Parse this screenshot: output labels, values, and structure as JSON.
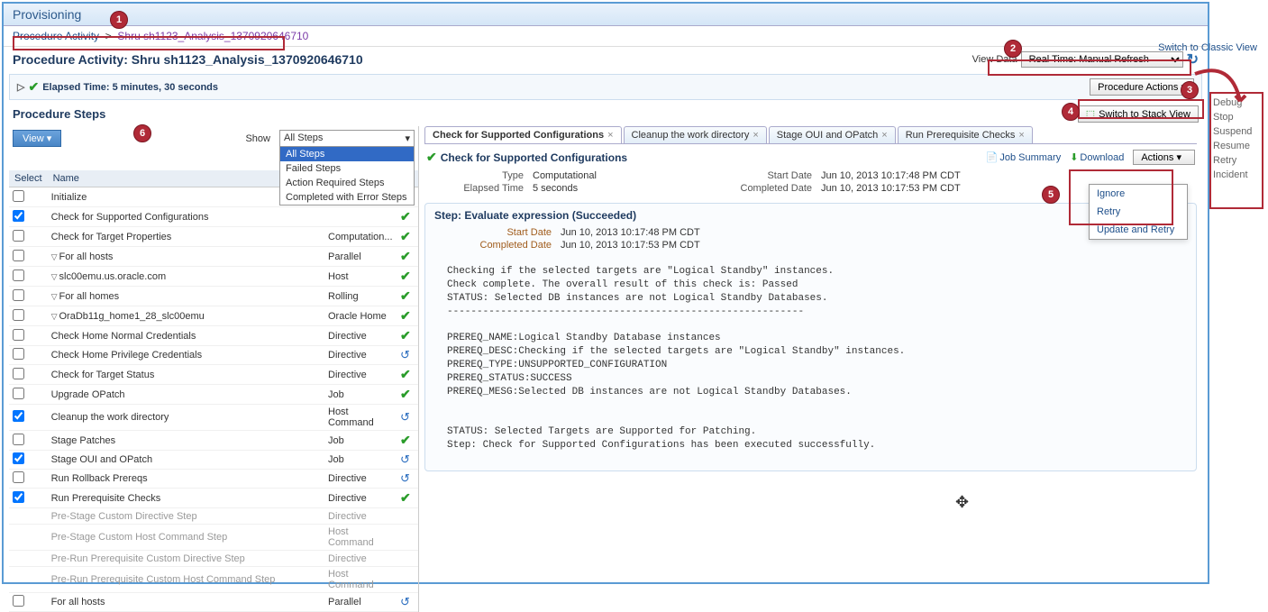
{
  "header": {
    "title": "Provisioning"
  },
  "breadcrumb": {
    "root": "Procedure Activity",
    "current": "Shru sh1123_Analysis_1370920646710"
  },
  "classic_link": "Switch to Classic View",
  "page_title": "Procedure Activity: Shru sh1123_Analysis_1370920646710",
  "viewdata": {
    "label": "View Data",
    "value": "Real Time: Manual Refresh"
  },
  "elapsed": {
    "label": "Elapsed Time: 5 minutes, 30 seconds"
  },
  "proc_actions": "Procedure Actions",
  "steps_header": "Procedure Steps",
  "stack_btn": "Switch to Stack View",
  "toolbar": {
    "view": "View",
    "show": "Show"
  },
  "filter": {
    "current": "All Steps",
    "options": [
      "All Steps",
      "Failed Steps",
      "Action Required Steps",
      "Completed with Error Steps"
    ]
  },
  "table": {
    "col_select": "Select",
    "col_name": "Name",
    "rows": [
      {
        "chk": 0,
        "indent": 1,
        "name": "Initialize",
        "type": "",
        "status": "ok"
      },
      {
        "chk": 1,
        "indent": 1,
        "name": "Check for Supported Configurations",
        "type": "",
        "status": "ok"
      },
      {
        "chk": 0,
        "indent": 1,
        "name": "Check for Target Properties",
        "type": "Computation...",
        "status": "ok"
      },
      {
        "chk": 0,
        "indent": 1,
        "exp": "▽",
        "name": "For all hosts",
        "type": "Parallel",
        "status": "ok"
      },
      {
        "chk": 0,
        "indent": 2,
        "exp": "▽",
        "name": "slc00emu.us.oracle.com",
        "type": "Host",
        "status": "ok"
      },
      {
        "chk": 0,
        "indent": 3,
        "exp": "▽",
        "name": "For all homes",
        "type": "Rolling",
        "status": "ok"
      },
      {
        "chk": 0,
        "indent": 4,
        "exp": "▽",
        "name": "OraDb11g_home1_28_slc00emu",
        "type": "Oracle Home",
        "status": "ok"
      },
      {
        "chk": 0,
        "indent": 5,
        "name": "Check Home Normal Credentials",
        "type": "Directive",
        "status": "ok"
      },
      {
        "chk": 0,
        "indent": 5,
        "name": "Check Home Privilege Credentials",
        "type": "Directive",
        "status": "run"
      },
      {
        "chk": 0,
        "indent": 5,
        "name": "Check for Target Status",
        "type": "Directive",
        "status": "ok"
      },
      {
        "chk": 0,
        "indent": 5,
        "name": "Upgrade OPatch",
        "type": "Job",
        "status": "ok"
      },
      {
        "chk": 1,
        "indent": 5,
        "name": "Cleanup the work directory",
        "type": "Host Command",
        "status": "run"
      },
      {
        "chk": 0,
        "indent": 5,
        "name": "Stage Patches",
        "type": "Job",
        "status": "ok"
      },
      {
        "chk": 1,
        "indent": 5,
        "name": "Stage OUI and OPatch",
        "type": "Job",
        "status": "run"
      },
      {
        "chk": 0,
        "indent": 5,
        "name": "Run Rollback Prereqs",
        "type": "Directive",
        "status": "run"
      },
      {
        "chk": 1,
        "indent": 5,
        "name": "Run Prerequisite Checks",
        "type": "Directive",
        "status": "ok"
      },
      {
        "chk": -1,
        "indent": 5,
        "name": "Pre-Stage Custom Directive Step",
        "type": "Directive",
        "disabled": true
      },
      {
        "chk": -1,
        "indent": 5,
        "name": "Pre-Stage Custom Host Command Step",
        "type": "Host Command",
        "disabled": true
      },
      {
        "chk": -1,
        "indent": 5,
        "name": "Pre-Run Prerequisite Custom Directive Step",
        "type": "Directive",
        "disabled": true
      },
      {
        "chk": -1,
        "indent": 5,
        "name": "Pre-Run Prerequisite Custom Host Command Step",
        "type": "Host Command",
        "disabled": true
      },
      {
        "chk": 0,
        "indent": 1,
        "name": "For all hosts",
        "type": "Parallel",
        "status": "run"
      }
    ]
  },
  "tabs": [
    {
      "label": "Check for Supported Configurations",
      "active": true
    },
    {
      "label": "Cleanup the work directory"
    },
    {
      "label": "Stage OUI and OPatch"
    },
    {
      "label": "Run Prerequisite Checks"
    }
  ],
  "detail": {
    "title": "Check for Supported Configurations",
    "links": {
      "summary": "Job Summary",
      "download": "Download",
      "actions": "Actions"
    },
    "type_k": "Type",
    "type_v": "Computational",
    "start_k": "Start Date",
    "start_v": "Jun 10, 2013 10:17:48 PM CDT",
    "elapsed_k": "Elapsed Time",
    "elapsed_v": "5 seconds",
    "completed_k": "Completed Date",
    "completed_v": "Jun 10, 2013 10:17:53 PM CDT"
  },
  "step": {
    "title": "Step: Evaluate expression (Succeeded)",
    "start_k": "Start Date",
    "start_v": "Jun 10, 2013 10:17:48 PM CDT",
    "comp_k": "Completed Date",
    "comp_v": "Jun 10, 2013 10:17:53 PM CDT",
    "log": "Checking if the selected targets are \"Logical Standby\" instances.\nCheck complete. The overall result of this check is: Passed\nSTATUS: Selected DB instances are not Logical Standby Databases.\n------------------------------------------------------------\n\nPREREQ_NAME:Logical Standby Database instances\nPREREQ_DESC:Checking if the selected targets are \"Logical Standby\" instances.\nPREREQ_TYPE:UNSUPPORTED_CONFIGURATION\nPREREQ_STATUS:SUCCESS\nPREREQ_MESG:Selected DB instances are not Logical Standby Databases.\n\n\nSTATUS: Selected Targets are Supported for Patching.\nStep: Check for Supported Configurations has been executed successfully."
  },
  "actions_menu": [
    "Ignore",
    "Retry",
    "Update and Retry"
  ],
  "side_menu": [
    "Debug",
    "Stop",
    "Suspend",
    "Resume",
    "Retry",
    "Incident"
  ],
  "callouts": {
    "1": "1",
    "2": "2",
    "3": "3",
    "4": "4",
    "5": "5",
    "6": "6"
  }
}
